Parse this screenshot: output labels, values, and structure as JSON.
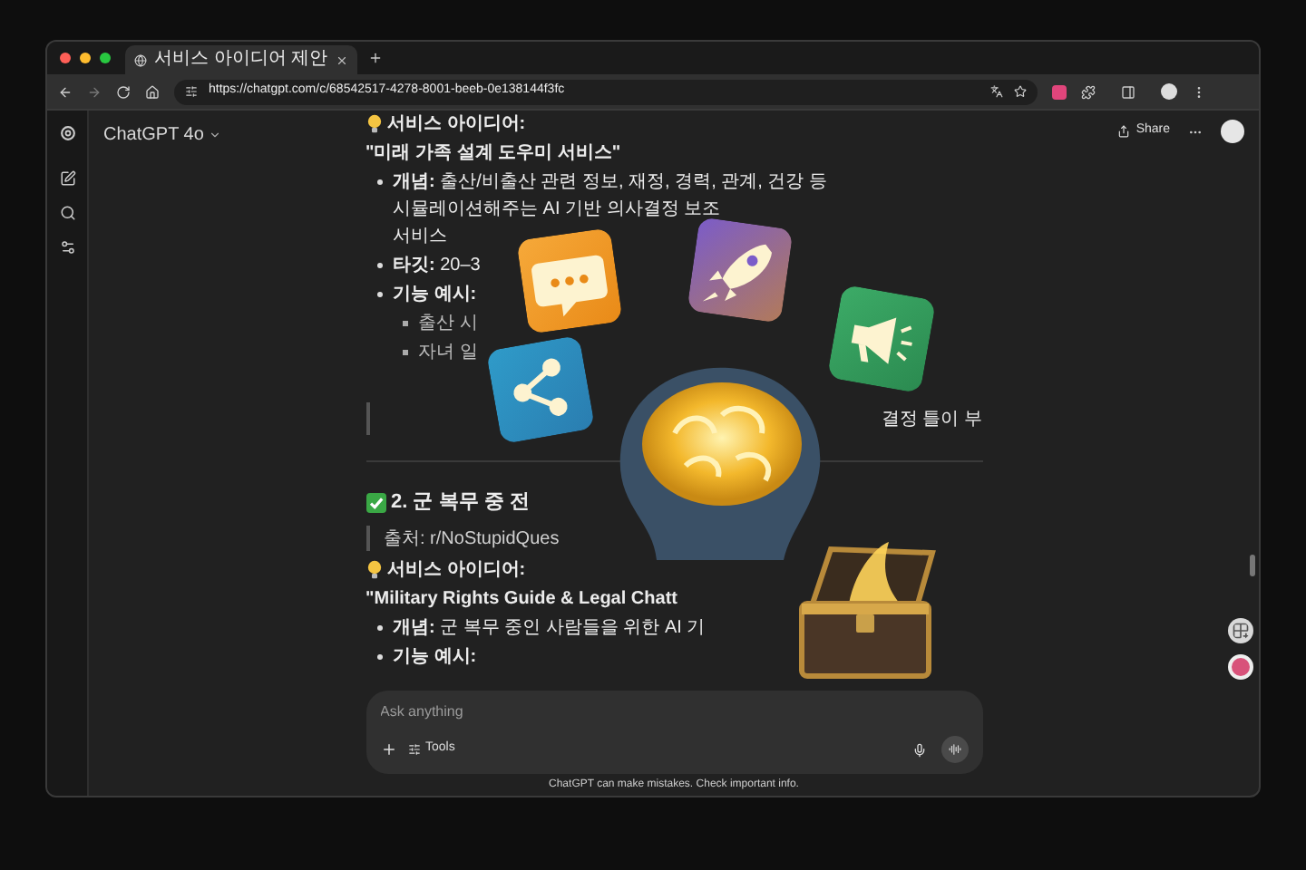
{
  "browser": {
    "tab_title": "서비스 아이디어 제안",
    "url": "https://chatgpt.com/c/68542517-4278-8001-beeb-0e138144f3fc"
  },
  "header": {
    "model": "ChatGPT 4o",
    "share": "Share"
  },
  "blocks": [
    {
      "kind": "label",
      "text": "서비스 아이디어:"
    },
    {
      "kind": "title",
      "text": "\"미래 가족 설계 도우미 서비스\""
    },
    {
      "kind": "bullet",
      "text": "**개념:** 출산/비출산 관련 정보, 재정, 경력, 관계, 건강 등"
    },
    {
      "kind": "continuation",
      "text": "시뮬레이션해주는 AI 기반 의사결정 보조"
    },
    {
      "kind": "continuation",
      "text": "서비스"
    },
    {
      "kind": "bullet",
      "text": "**타깃:** 20–3"
    },
    {
      "kind": "bullet",
      "text": "**기능 예시:**"
    },
    {
      "kind": "sub_bullet",
      "text": "출산 시"
    },
    {
      "kind": "sub_bullet",
      "text": "자녀 일"
    },
    {
      "kind": "quote_fragment",
      "text": "결정 틀이 부"
    },
    {
      "kind": "heading",
      "text": "2. 군 복무 중 전"
    },
    {
      "kind": "quote",
      "text": "출처: r/NoStupidQues"
    },
    {
      "kind": "label",
      "text": "서비스 아이디어:"
    },
    {
      "kind": "title",
      "text": "\"Military Rights Guide & Legal Chatt"
    },
    {
      "kind": "bullet",
      "text": "**개념:** 군 복무 중인 사람들을 위한 AI 기"
    },
    {
      "kind": "bullet",
      "text": "**기능 예시:**"
    }
  ],
  "composer": {
    "placeholder": "Ask anything",
    "tools": "Tools"
  },
  "footer": "ChatGPT can make mistakes. Check important info."
}
